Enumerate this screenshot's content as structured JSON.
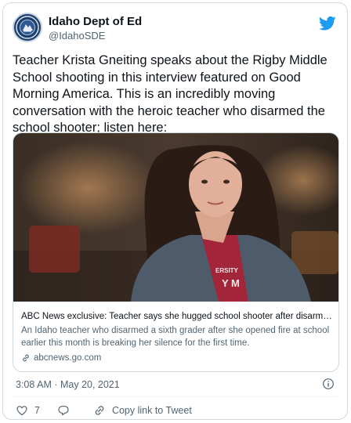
{
  "account": {
    "name": "Idaho Dept of Ed",
    "handle": "@IdahoSDE"
  },
  "tweet": {
    "text": "Teacher Krista Gneiting speaks about the Rigby Middle School shooting in this interview featured on Good Morning America. This is an incredibly moving conversation with the heroic teacher who disarmed the school shooter; listen here:",
    "timestamp": "3:08 AM · May 20, 2021"
  },
  "card": {
    "title": "ABC News exclusive: Teacher says she hugged school shooter after disarming her",
    "description": "An Idaho teacher who disarmed a sixth grader after she opened fire at school earlier this month is breaking her silence for the first time.",
    "domain": "abcnews.go.com",
    "shirt_text": "ERSITY\nY M"
  },
  "actions": {
    "likes": "7",
    "copy_link": "Copy link to Tweet"
  },
  "colors": {
    "brand_blue": "#1d9bf0",
    "like_red": "#f91880",
    "text_secondary": "#536471"
  },
  "icons": [
    "twitter-bird-icon",
    "info-icon",
    "heart-icon",
    "reply-icon",
    "link-icon"
  ]
}
